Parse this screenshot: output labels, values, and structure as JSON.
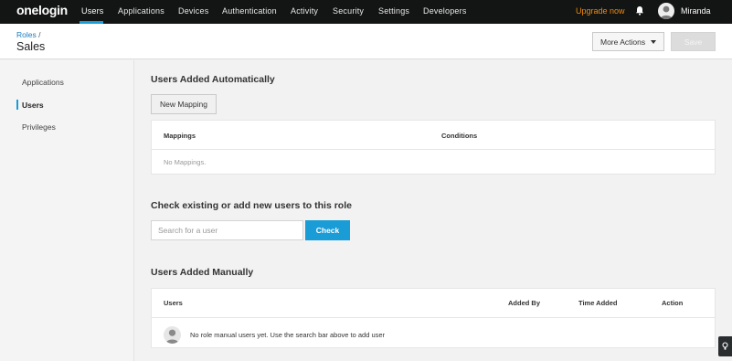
{
  "brand": {
    "logo_text": "onelogin",
    "accent": "#1a9cd6",
    "upgrade_color": "#f48c0a"
  },
  "topnav": {
    "items": [
      "Users",
      "Applications",
      "Devices",
      "Authentication",
      "Activity",
      "Security",
      "Settings",
      "Developers"
    ],
    "active": "Users",
    "upgrade_label": "Upgrade now",
    "user_name": "Miranda",
    "icons": [
      "bell-icon",
      "user-avatar"
    ]
  },
  "header": {
    "breadcrumb_root": "Roles",
    "breadcrumb_sep": "/",
    "title": "Sales",
    "more_actions_label": "More Actions",
    "save_label": "Save"
  },
  "sidebar": {
    "items": [
      "Applications",
      "Users",
      "Privileges"
    ],
    "active": "Users"
  },
  "auto": {
    "title": "Users Added Automatically",
    "new_mapping_label": "New Mapping",
    "columns": [
      "Mappings",
      "Conditions"
    ],
    "empty_text": "No Mappings."
  },
  "check": {
    "title": "Check existing or add new users to this role",
    "search_placeholder": "Search for a user",
    "search_value": "",
    "check_label": "Check"
  },
  "manual": {
    "title": "Users Added Manually",
    "columns": [
      "Users",
      "Added By",
      "Time Added",
      "Action"
    ],
    "empty_text": "No role manual users yet. Use the search bar above to add user"
  }
}
